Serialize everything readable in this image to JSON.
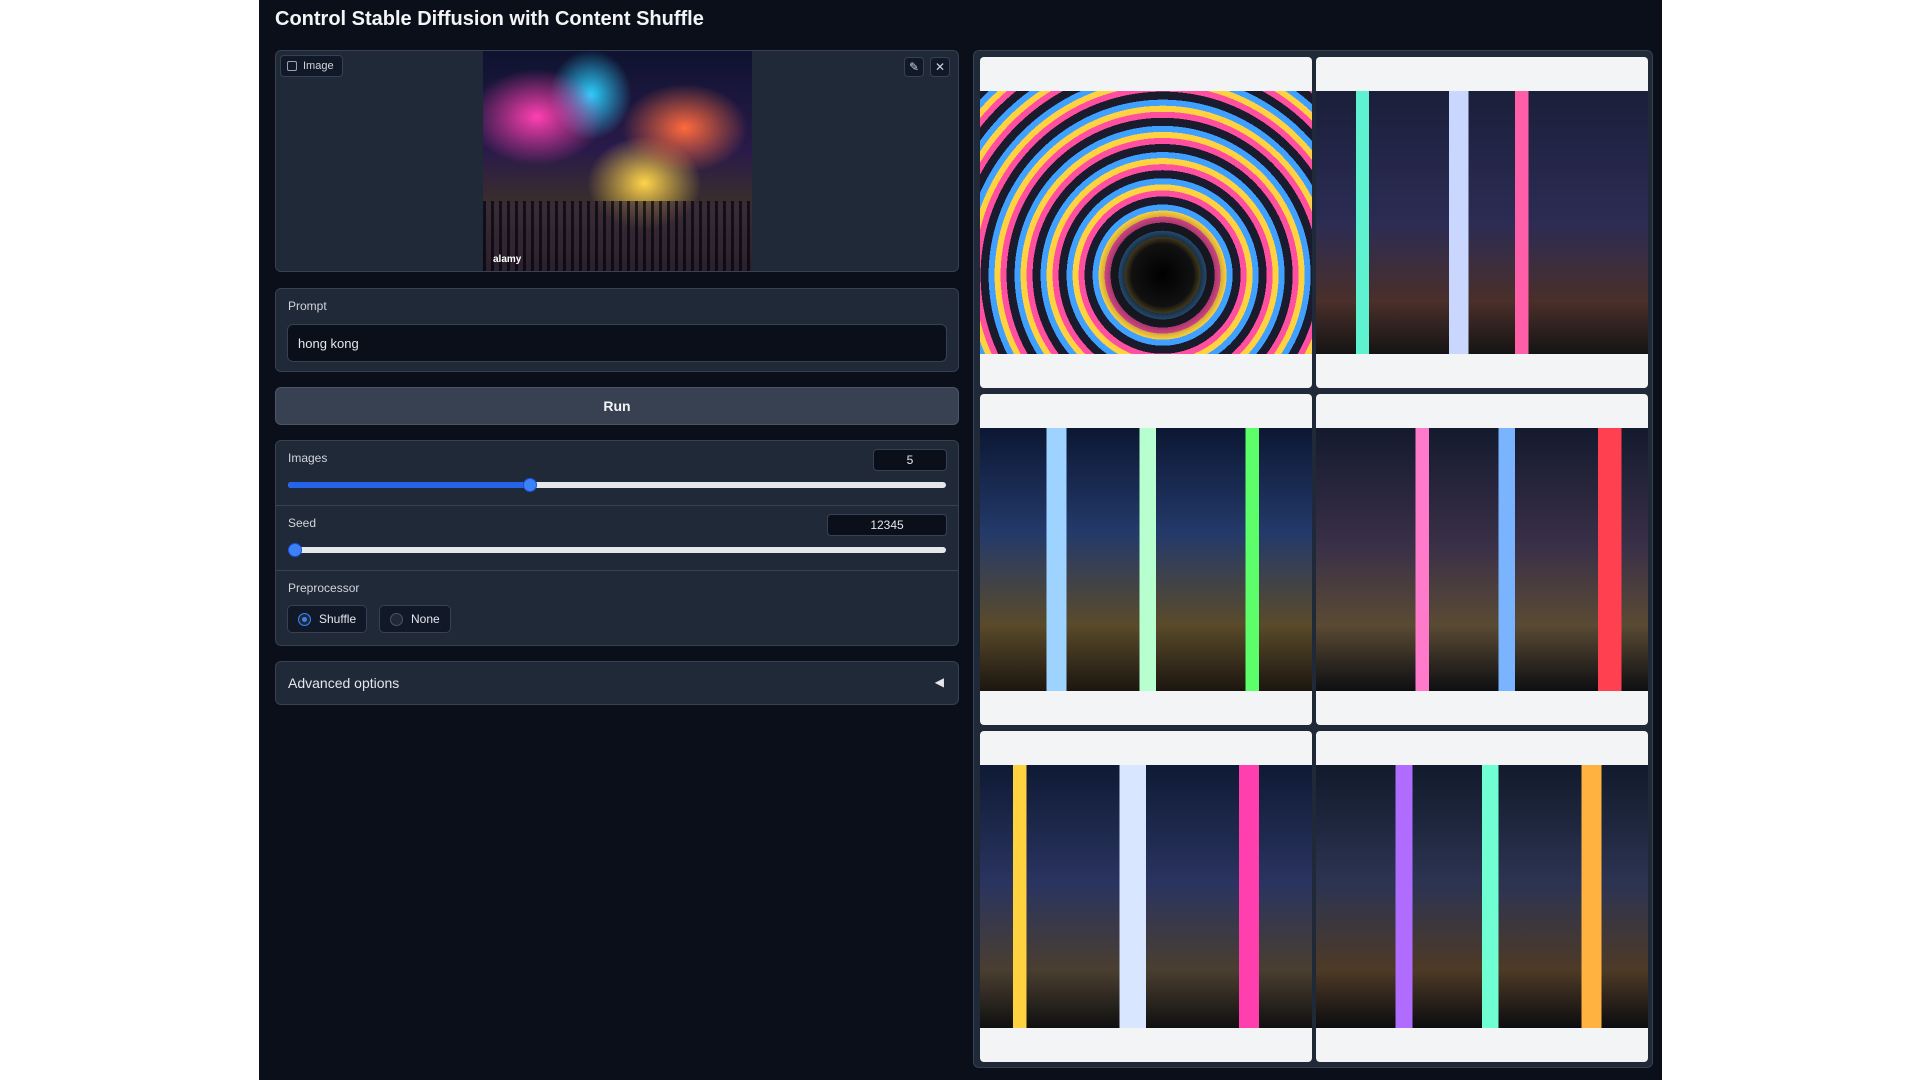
{
  "app": {
    "title": "Control Stable Diffusion with Content Shuffle"
  },
  "image_input": {
    "label": "Image",
    "preview_watermark": "alamy",
    "tools": {
      "edit_icon": "✎",
      "clear_icon": "✕"
    }
  },
  "prompt": {
    "label": "Prompt",
    "value": "hong kong"
  },
  "run_button": {
    "label": "Run"
  },
  "settings": {
    "images": {
      "label": "Images",
      "value": "5",
      "fraction": 0.368
    },
    "seed": {
      "label": "Seed",
      "value": "12345",
      "fraction": 0.0
    },
    "preprocessor": {
      "label": "Preprocessor",
      "options": [
        "Shuffle",
        "None"
      ],
      "selected": "Shuffle"
    }
  },
  "advanced": {
    "label": "Advanced options",
    "caret": "◀"
  },
  "gallery": {
    "count": 6
  },
  "colors": {
    "accent": "#3b82f6",
    "background": "#0b0f19",
    "panel": "#1f2937"
  }
}
